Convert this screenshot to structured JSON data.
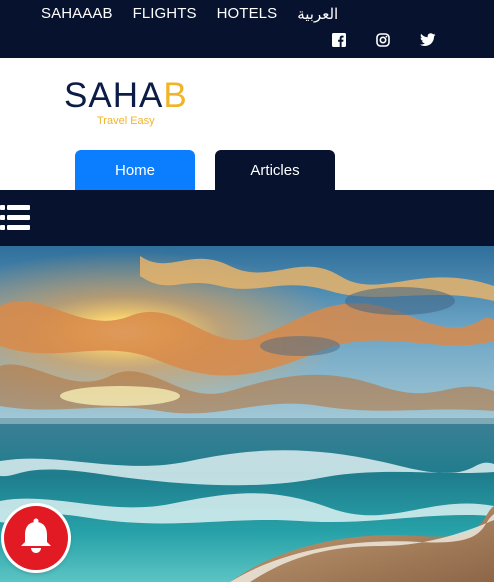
{
  "top_nav": {
    "items": [
      {
        "label": "SAHAAAB"
      },
      {
        "label": "FLIGHTS"
      },
      {
        "label": "HOTELS"
      },
      {
        "label": "العربية"
      }
    ]
  },
  "social": {
    "icons": [
      "facebook-icon",
      "instagram-icon",
      "twitter-icon"
    ]
  },
  "logo": {
    "main_dark": "SAHA",
    "main_accent": "B",
    "tagline": "Travel Easy"
  },
  "tabs": [
    {
      "label": "Home",
      "active": true
    },
    {
      "label": "Articles",
      "active": false
    }
  ],
  "menu": {
    "icon": "list-menu-icon"
  },
  "hero": {
    "image": "beach-sunset-photo"
  },
  "notification": {
    "icon": "bell-icon"
  },
  "colors": {
    "navy": "#07132e",
    "accent_blue": "#0b7dff",
    "brand_gold": "#f0b429",
    "bell_red": "#e11a24"
  }
}
